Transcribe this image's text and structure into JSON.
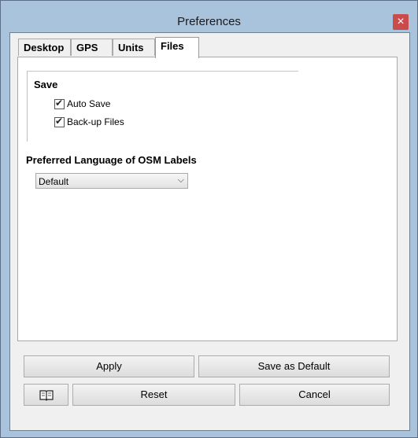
{
  "window": {
    "title": "Preferences",
    "close_glyph": "×"
  },
  "tabs": [
    {
      "label": "Desktop"
    },
    {
      "label": "GPS"
    },
    {
      "label": "Units"
    },
    {
      "label": "Files",
      "active": true
    }
  ],
  "files": {
    "save_group": {
      "title": "Save",
      "auto_save": {
        "label": "Auto Save",
        "checked": true
      },
      "backup_files": {
        "label": "Back-up Files",
        "checked": true
      }
    },
    "language": {
      "label": "Preferred Language of OSM Labels",
      "selected": "Default"
    }
  },
  "buttons": {
    "apply": "Apply",
    "save_default": "Save as Default",
    "reset": "Reset",
    "cancel": "Cancel",
    "help_icon": "book-icon"
  },
  "colors": {
    "title_bar": "#aac3dc",
    "close_button": "#c94b4b",
    "client_bg": "#f0f0f0"
  }
}
